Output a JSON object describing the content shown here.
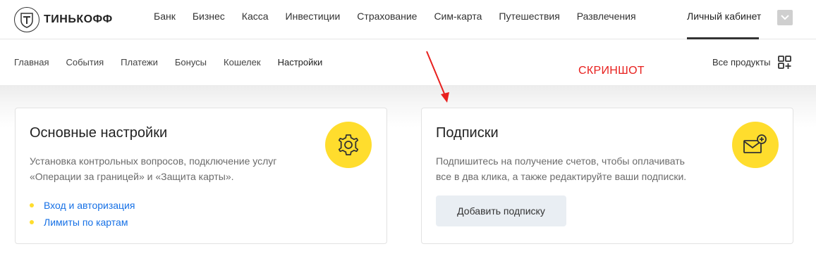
{
  "brand": {
    "name": "ТИНЬКОФФ",
    "logo_icon": "tinkoff-logo-icon"
  },
  "top_nav": [
    "Банк",
    "Бизнес",
    "Касса",
    "Инвестиции",
    "Страхование",
    "Сим-карта",
    "Путешествия",
    "Развлечения"
  ],
  "cabinet_label": "Личный кабинет",
  "sub_nav": [
    "Главная",
    "События",
    "Платежи",
    "Бонусы",
    "Кошелек",
    "Настройки"
  ],
  "sub_nav_active": "Настройки",
  "annotation": {
    "text": "СКРИНШОТ",
    "color": "#e8201e"
  },
  "all_products_label": "Все продукты",
  "cards": [
    {
      "title": "Основные настройки",
      "text_line1": "Установка контрольных вопросов, подключение услуг",
      "text_line2": "«Операции за границей» и «Защита карты».",
      "icon": "gear-icon",
      "links": [
        "Вход и авторизация",
        "Лимиты по картам"
      ]
    },
    {
      "title": "Подписки",
      "text_line1": "Подпишитесь на получение счетов, чтобы оплачивать",
      "text_line2": "все в два клика, а также редактируйте ваши подписки.",
      "icon": "mail-add-icon",
      "button_label": "Добавить подписку"
    }
  ],
  "colors": {
    "accent_yellow": "#ffdd2d",
    "link_blue": "#1771e6"
  }
}
